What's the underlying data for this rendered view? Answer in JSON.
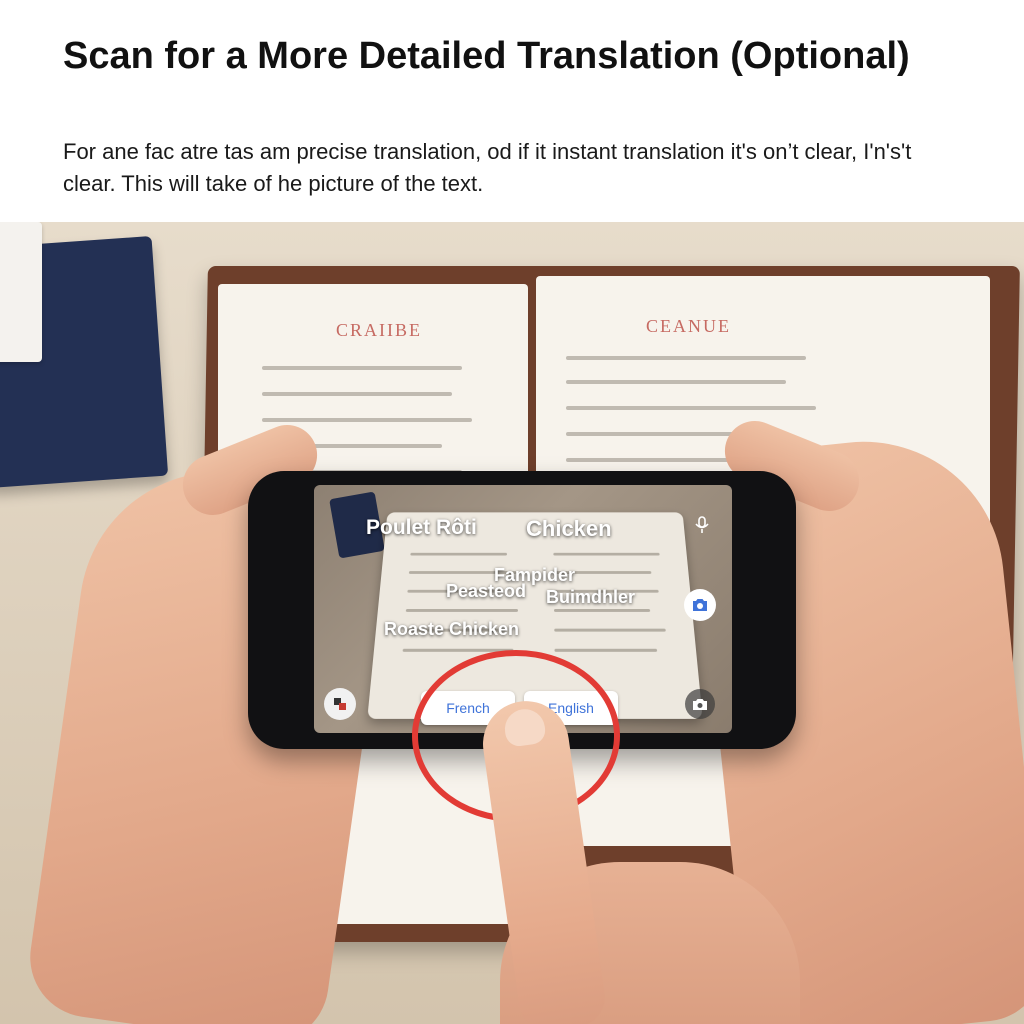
{
  "header": {
    "title": "Scan for a More Detailed Translation (Optional)",
    "description": "For ane fac atre tas am precise translation, od if it instant translation it's on’t clear, I'n's't clear. This will take of he picture of the text."
  },
  "menu": {
    "left_heading": "CRAIIBE",
    "right_heading": "CEANUE"
  },
  "phone_screen": {
    "ar_labels": [
      "Poulet Rôti",
      "Chicken",
      "Fampider",
      "Peasteod",
      "Buimdhler",
      "Roaste Chicken"
    ],
    "source_language": "French",
    "target_language": "English",
    "icons": [
      "microphone-icon",
      "camera-icon",
      "camera-shutter-icon",
      "translate-app-icon"
    ]
  },
  "colors": {
    "highlight_ring": "#e23b35",
    "language_text": "#3f73d9"
  }
}
